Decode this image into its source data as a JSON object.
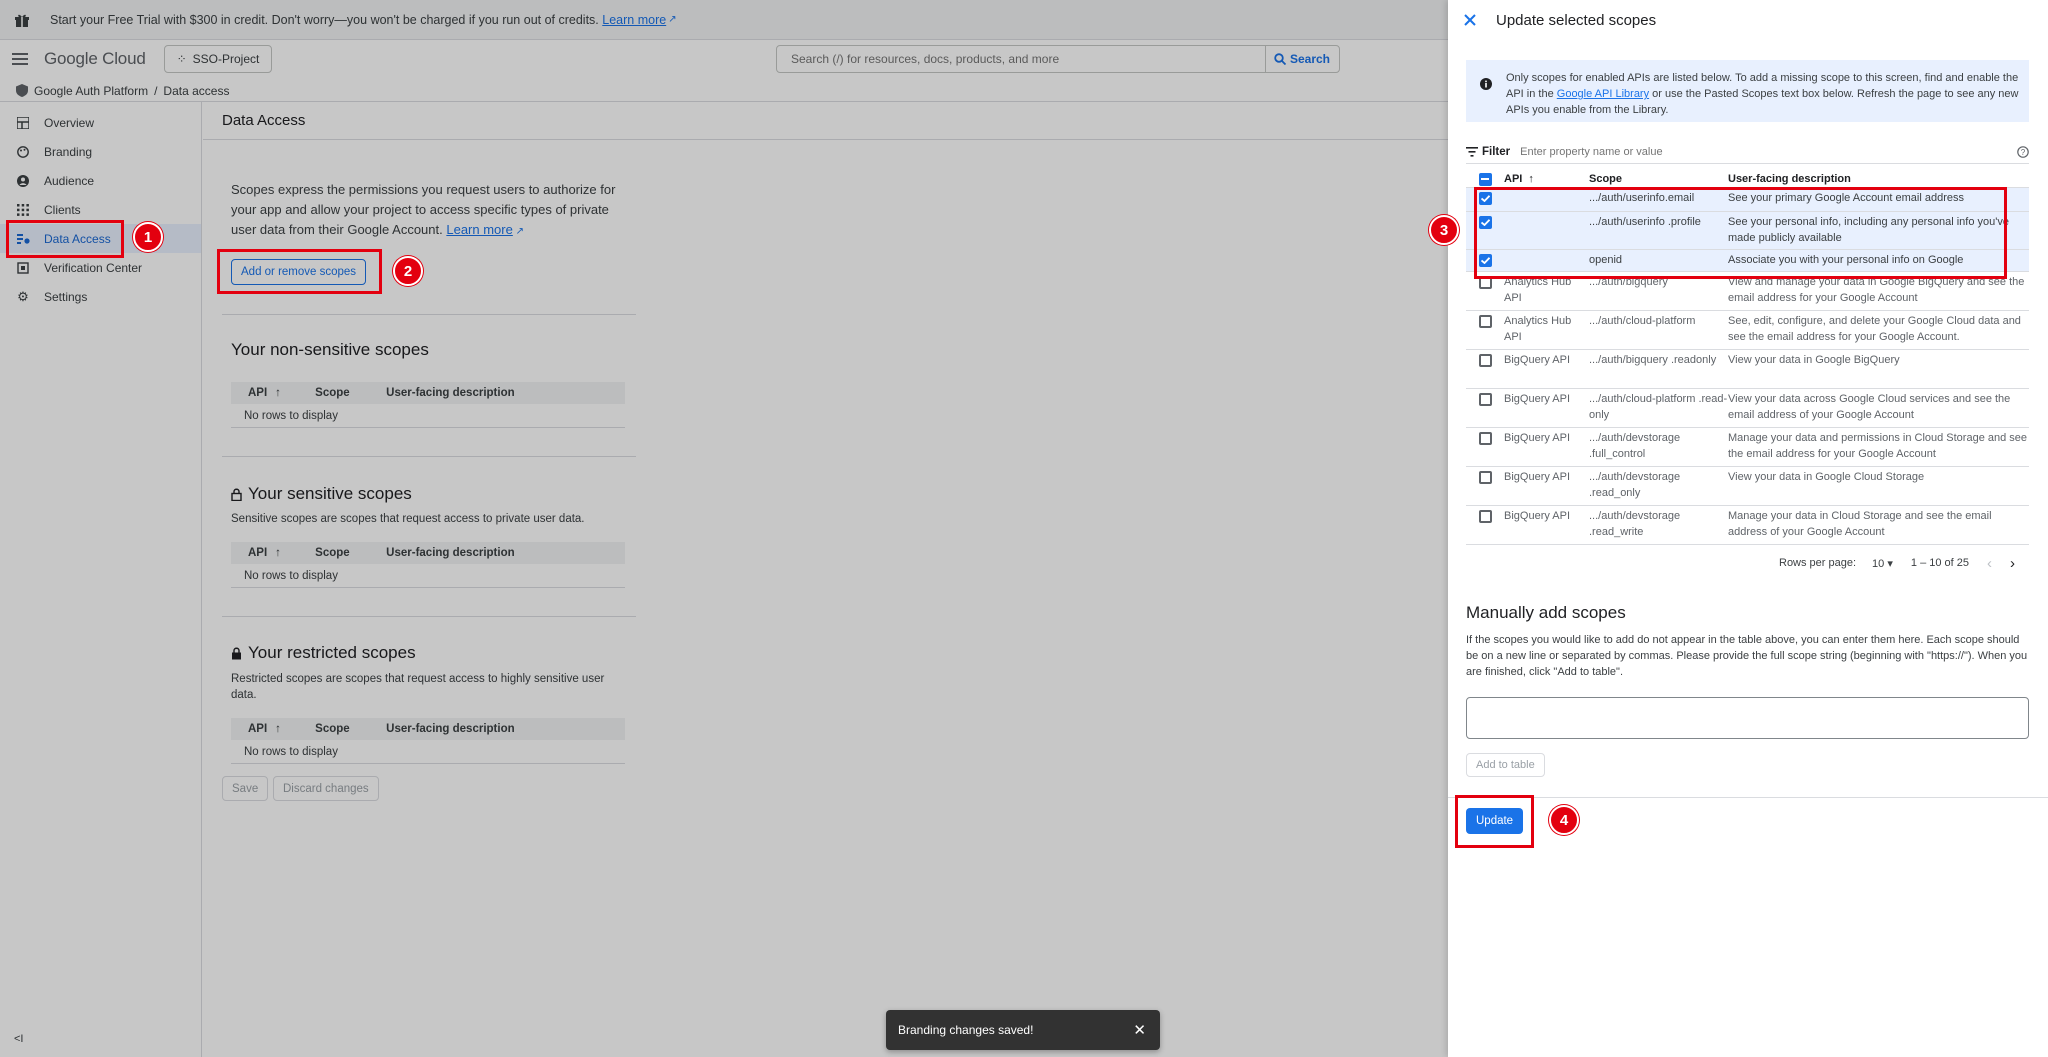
{
  "promo": {
    "text": "Start your Free Trial with $300 in credit. Don't worry—you won't be charged if you run out of credits.",
    "link": "Learn more"
  },
  "header": {
    "logo_google": "Google",
    "logo_cloud": "Cloud",
    "project": "SSO-Project",
    "search_placeholder": "Search (/) for resources, docs, products, and more",
    "search_button": "Search"
  },
  "breadcrumb": {
    "root": "Google Auth Platform",
    "sep": "/",
    "current": "Data access"
  },
  "sidebar": {
    "items": [
      {
        "label": "Overview",
        "icon": "dashboard-icon"
      },
      {
        "label": "Branding",
        "icon": "palette-icon"
      },
      {
        "label": "Audience",
        "icon": "person-circle-icon"
      },
      {
        "label": "Clients",
        "icon": "grid-icon"
      },
      {
        "label": "Data Access",
        "icon": "data-access-icon"
      },
      {
        "label": "Verification Center",
        "icon": "verified-icon"
      },
      {
        "label": "Settings",
        "icon": "gear-icon"
      }
    ],
    "collapse": "<I"
  },
  "main": {
    "title": "Data Access",
    "intro": "Scopes express the permissions you request users to authorize for your app and allow your project to access specific types of private user data from their Google Account.",
    "intro_link": "Learn more",
    "add_button": "Add or remove scopes",
    "nonsensitive": {
      "title": "Your non-sensitive scopes",
      "cols": [
        "API",
        "Scope",
        "User-facing description"
      ],
      "empty": "No rows to display"
    },
    "sensitive": {
      "title": "Your sensitive scopes",
      "desc": "Sensitive scopes are scopes that request access to private user data.",
      "cols": [
        "API",
        "Scope",
        "User-facing description"
      ],
      "empty": "No rows to display"
    },
    "restricted": {
      "title": "Your restricted scopes",
      "desc": "Restricted scopes are scopes that request access to highly sensitive user data.",
      "cols": [
        "API",
        "Scope",
        "User-facing description"
      ],
      "empty": "No rows to display"
    },
    "save": "Save",
    "discard": "Discard changes"
  },
  "toast": {
    "text": "Branding changes saved!"
  },
  "panel": {
    "title": "Update selected scopes",
    "info_pre": "Only scopes for enabled APIs are listed below. To add a missing scope to this screen, find and enable the API in the",
    "info_link": "Google API Library",
    "info_post": "or use the Pasted Scopes text box below. Refresh the page to see any new APIs you enable from the Library.",
    "filter_label": "Filter",
    "filter_placeholder": "Enter property name or value",
    "columns": [
      "API",
      "Scope",
      "User-facing description"
    ],
    "rows": [
      {
        "checked": true,
        "api": "",
        "scope": ".../auth/userinfo.email",
        "desc": "See your primary Google Account email address"
      },
      {
        "checked": true,
        "api": "",
        "scope": ".../auth/userinfo .profile",
        "desc": "See your personal info, including any personal info you've made publicly available"
      },
      {
        "checked": true,
        "api": "",
        "scope": "openid",
        "desc": "Associate you with your personal info on Google"
      },
      {
        "checked": false,
        "api": "Analytics Hub API",
        "scope": ".../auth/bigquery",
        "desc": "View and manage your data in Google BigQuery and see the email address for your Google Account"
      },
      {
        "checked": false,
        "api": "Analytics Hub API",
        "scope": ".../auth/cloud-platform",
        "desc": "See, edit, configure, and delete your Google Cloud data and see the email address for your Google Account."
      },
      {
        "checked": false,
        "api": "BigQuery API",
        "scope": ".../auth/bigquery .readonly",
        "desc": "View your data in Google BigQuery"
      },
      {
        "checked": false,
        "api": "BigQuery API",
        "scope": ".../auth/cloud-platform .read-only",
        "desc": "View your data across Google Cloud services and see the email address of your Google Account"
      },
      {
        "checked": false,
        "api": "BigQuery API",
        "scope": ".../auth/devstorage .full_control",
        "desc": "Manage your data and permissions in Cloud Storage and see the email address for your Google Account"
      },
      {
        "checked": false,
        "api": "BigQuery API",
        "scope": ".../auth/devstorage .read_only",
        "desc": "View your data in Google Cloud Storage"
      },
      {
        "checked": false,
        "api": "BigQuery API",
        "scope": ".../auth/devstorage .read_write",
        "desc": "Manage your data in Cloud Storage and see the email address of your Google Account"
      }
    ],
    "pager": {
      "rows_label": "Rows per page:",
      "rows_value": "10",
      "range": "1 – 10 of 25"
    },
    "manual_title": "Manually add scopes",
    "manual_desc": "If the scopes you would like to add do not appear in the table above, you can enter them here. Each scope should be on a new line or separated by commas. Please provide the full scope string (beginning with \"https://\"). When you are finished, click \"Add to table\".",
    "add_to_table": "Add to table",
    "update": "Update"
  },
  "annotations": [
    "1",
    "2",
    "3",
    "4"
  ],
  "colors": {
    "accent": "#1a73e8",
    "annotation": "#e3000f",
    "selected_row": "#e8f0fe"
  }
}
